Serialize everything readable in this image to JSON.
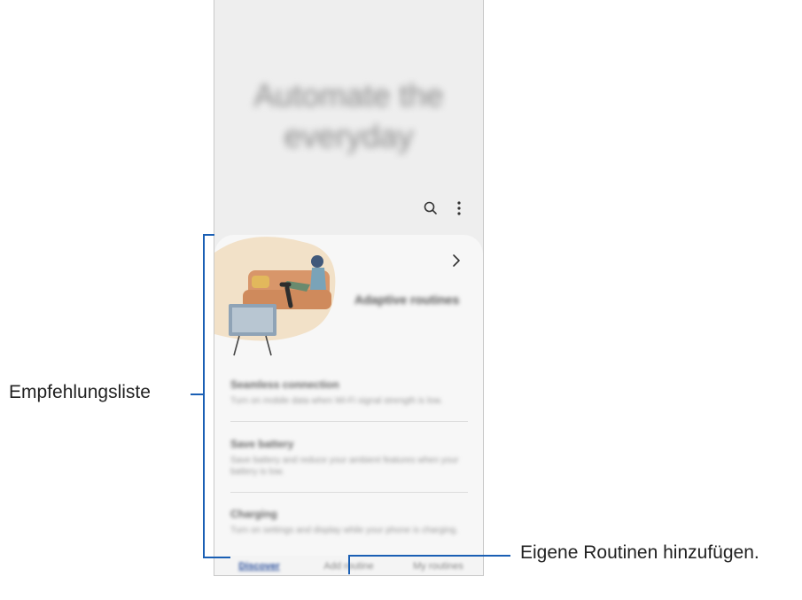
{
  "hero": {
    "title_line1": "Automate the",
    "title_line2": "everyday"
  },
  "icons": {
    "search": "search-icon",
    "more": "more-options-icon",
    "chevron": "chevron-right-icon"
  },
  "featured": {
    "title": "Adaptive routines"
  },
  "recommendations": [
    {
      "title": "Seamless connection",
      "description": "Turn on mobile data when Wi-Fi signal strength is low."
    },
    {
      "title": "Save battery",
      "description": "Save battery and reduce your ambient features when your battery is low."
    },
    {
      "title": "Charging",
      "description": "Turn on settings and display while your phone is charging."
    }
  ],
  "bottom_nav": {
    "discover": "Discover",
    "add_routine": "Add routine",
    "my_routines": "My routines"
  },
  "callouts": {
    "recommendation_list": "Empfehlungsliste",
    "add_own": "Eigene Routinen hinzufügen."
  },
  "colors": {
    "bracket": "#1a5fb4",
    "active_tab": "#2a4f9c"
  }
}
